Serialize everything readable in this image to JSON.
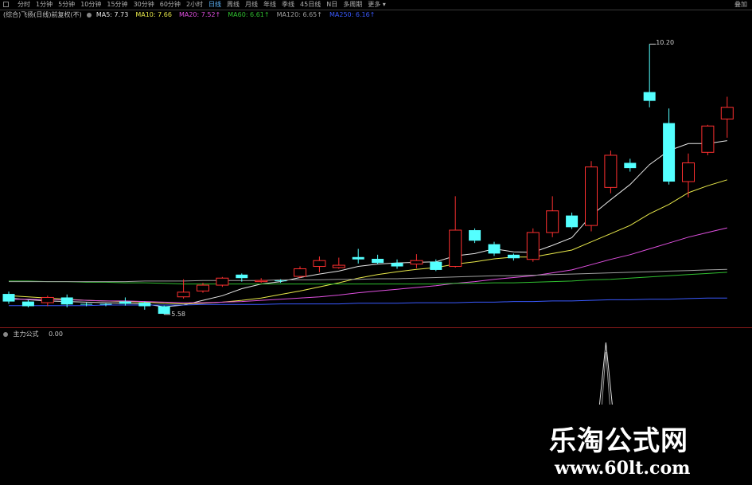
{
  "toolbar": {
    "periods": [
      "分时",
      "1分钟",
      "5分钟",
      "10分钟",
      "15分钟",
      "30分钟",
      "60分钟",
      "2小时",
      "日线",
      "周线",
      "月线",
      "年线",
      "季线",
      "45日线",
      "N日",
      "多周期"
    ],
    "active_period": "日线",
    "more_label": "更多",
    "right_buttons": [
      "叠加"
    ]
  },
  "ma_bar": {
    "title": "(综合)飞扬(日线)前复权(不)",
    "items": [
      {
        "label": "MA5: 7.73",
        "color": "#e6e6e6"
      },
      {
        "label": "MA10: 7.66",
        "color": "#e8e84a"
      },
      {
        "label": "MA20: 7.52↑",
        "color": "#e050e0"
      },
      {
        "label": "MA60: 6.61↑",
        "color": "#30c030"
      },
      {
        "label": "MA120: 6.65↑",
        "color": "#a0a0a0"
      },
      {
        "label": "MA250: 6.16↑",
        "color": "#3a5aff"
      }
    ]
  },
  "annotations": {
    "high": "10.20",
    "low": "5.58"
  },
  "sub_chart": {
    "title": "主力公式",
    "value": "0.00"
  },
  "watermark": {
    "line1": "乐淘公式网",
    "line2": "www.60lt.com"
  },
  "colors": {
    "up": "#ff3030",
    "down": "#54ffff",
    "background": "#000000"
  },
  "chart_data": {
    "type": "candlestick",
    "ylim": [
      5.4,
      10.6
    ],
    "candles": [
      {
        "o": 5.93,
        "c": 5.8,
        "h": 5.97,
        "l": 5.76
      },
      {
        "o": 5.8,
        "c": 5.72,
        "h": 5.83,
        "l": 5.7
      },
      {
        "o": 5.78,
        "c": 5.87,
        "h": 5.9,
        "l": 5.72
      },
      {
        "o": 5.87,
        "c": 5.75,
        "h": 5.92,
        "l": 5.7
      },
      {
        "o": 5.76,
        "c": 5.75,
        "h": 5.78,
        "l": 5.72
      },
      {
        "o": 5.76,
        "c": 5.75,
        "h": 5.77,
        "l": 5.72
      },
      {
        "o": 5.8,
        "c": 5.76,
        "h": 5.87,
        "l": 5.73
      },
      {
        "o": 5.78,
        "c": 5.72,
        "h": 5.8,
        "l": 5.66
      },
      {
        "o": 5.72,
        "c": 5.59,
        "h": 5.73,
        "l": 5.58
      },
      {
        "o": 5.88,
        "c": 5.96,
        "h": 6.18,
        "l": 5.85
      },
      {
        "o": 5.98,
        "c": 6.08,
        "h": 6.12,
        "l": 5.95
      },
      {
        "o": 6.08,
        "c": 6.2,
        "h": 6.22,
        "l": 6.05
      },
      {
        "o": 6.26,
        "c": 6.2,
        "h": 6.28,
        "l": 6.14
      },
      {
        "o": 6.14,
        "c": 6.16,
        "h": 6.2,
        "l": 6.12
      },
      {
        "o": 6.16,
        "c": 6.15,
        "h": 6.18,
        "l": 6.12
      },
      {
        "o": 6.23,
        "c": 6.36,
        "h": 6.4,
        "l": 6.2
      },
      {
        "o": 6.4,
        "c": 6.5,
        "h": 6.57,
        "l": 6.3
      },
      {
        "o": 6.38,
        "c": 6.42,
        "h": 6.55,
        "l": 6.36
      },
      {
        "o": 6.56,
        "c": 6.52,
        "h": 6.7,
        "l": 6.45
      },
      {
        "o": 6.53,
        "c": 6.46,
        "h": 6.6,
        "l": 6.44
      },
      {
        "o": 6.46,
        "c": 6.4,
        "h": 6.52,
        "l": 6.36
      },
      {
        "o": 6.44,
        "c": 6.5,
        "h": 6.61,
        "l": 6.37
      },
      {
        "o": 6.48,
        "c": 6.34,
        "h": 6.52,
        "l": 6.32
      },
      {
        "o": 6.4,
        "c": 7.02,
        "h": 7.6,
        "l": 6.38
      },
      {
        "o": 7.02,
        "c": 6.84,
        "h": 7.05,
        "l": 6.8
      },
      {
        "o": 6.78,
        "c": 6.62,
        "h": 6.82,
        "l": 6.58
      },
      {
        "o": 6.6,
        "c": 6.54,
        "h": 6.62,
        "l": 6.5
      },
      {
        "o": 6.52,
        "c": 6.98,
        "h": 7.05,
        "l": 6.48
      },
      {
        "o": 6.98,
        "c": 7.35,
        "h": 7.6,
        "l": 6.9
      },
      {
        "o": 7.27,
        "c": 7.07,
        "h": 7.32,
        "l": 7.04
      },
      {
        "o": 7.1,
        "c": 8.1,
        "h": 8.2,
        "l": 7.0
      },
      {
        "o": 7.75,
        "c": 8.3,
        "h": 8.38,
        "l": 7.65
      },
      {
        "o": 8.17,
        "c": 8.08,
        "h": 8.24,
        "l": 8.02
      },
      {
        "o": 9.38,
        "c": 9.23,
        "h": 10.2,
        "l": 9.12
      },
      {
        "o": 8.85,
        "c": 7.85,
        "h": 9.1,
        "l": 7.8
      },
      {
        "o": 7.85,
        "c": 8.17,
        "h": 8.33,
        "l": 7.58
      },
      {
        "o": 8.35,
        "c": 8.8,
        "h": 8.82,
        "l": 8.3
      },
      {
        "o": 8.92,
        "c": 9.12,
        "h": 9.3,
        "l": 8.6
      }
    ],
    "ma": [
      {
        "name": "MA5",
        "color": "#e6e6e6",
        "values": [
          5.86,
          5.83,
          5.81,
          5.8,
          5.79,
          5.78,
          5.77,
          5.76,
          5.71,
          5.74,
          5.82,
          5.9,
          6.02,
          6.1,
          6.14,
          6.21,
          6.27,
          6.32,
          6.4,
          6.44,
          6.46,
          6.47,
          6.48,
          6.58,
          6.62,
          6.7,
          6.65,
          6.64,
          6.76,
          6.89,
          7.27,
          7.54,
          7.8,
          8.14,
          8.38,
          8.5,
          8.5,
          8.55
        ]
      },
      {
        "name": "MA10",
        "color": "#e8e84a",
        "values": [
          5.9,
          5.88,
          5.86,
          5.84,
          5.82,
          5.81,
          5.8,
          5.79,
          5.77,
          5.76,
          5.77,
          5.79,
          5.82,
          5.86,
          5.92,
          5.98,
          6.05,
          6.12,
          6.2,
          6.26,
          6.31,
          6.35,
          6.38,
          6.44,
          6.48,
          6.53,
          6.56,
          6.56,
          6.62,
          6.68,
          6.82,
          6.96,
          7.1,
          7.3,
          7.46,
          7.66,
          7.78,
          7.88
        ]
      },
      {
        "name": "MA20",
        "color": "#e050e0",
        "values": [
          5.84,
          5.84,
          5.83,
          5.83,
          5.82,
          5.81,
          5.81,
          5.8,
          5.79,
          5.78,
          5.78,
          5.79,
          5.8,
          5.82,
          5.84,
          5.86,
          5.88,
          5.91,
          5.95,
          5.98,
          6.01,
          6.04,
          6.07,
          6.11,
          6.14,
          6.18,
          6.21,
          6.24,
          6.29,
          6.34,
          6.43,
          6.52,
          6.6,
          6.7,
          6.8,
          6.9,
          6.98,
          7.06
        ]
      },
      {
        "name": "MA60",
        "color": "#30c030",
        "values": [
          6.15,
          6.15,
          6.14,
          6.14,
          6.13,
          6.13,
          6.12,
          6.12,
          6.11,
          6.1,
          6.1,
          6.1,
          6.1,
          6.1,
          6.1,
          6.1,
          6.1,
          6.1,
          6.1,
          6.1,
          6.1,
          6.1,
          6.1,
          6.11,
          6.11,
          6.12,
          6.12,
          6.13,
          6.14,
          6.15,
          6.17,
          6.18,
          6.2,
          6.22,
          6.24,
          6.26,
          6.28,
          6.3
        ]
      },
      {
        "name": "MA120",
        "color": "#a0a0a0",
        "values": [
          6.14,
          6.14,
          6.14,
          6.14,
          6.14,
          6.14,
          6.14,
          6.15,
          6.15,
          6.15,
          6.16,
          6.16,
          6.16,
          6.16,
          6.17,
          6.17,
          6.17,
          6.18,
          6.18,
          6.19,
          6.19,
          6.2,
          6.21,
          6.22,
          6.23,
          6.24,
          6.24,
          6.25,
          6.26,
          6.27,
          6.28,
          6.29,
          6.3,
          6.31,
          6.32,
          6.33,
          6.34,
          6.35
        ]
      },
      {
        "name": "MA250",
        "color": "#3a5aff",
        "values": [
          5.73,
          5.73,
          5.73,
          5.73,
          5.73,
          5.74,
          5.74,
          5.74,
          5.74,
          5.74,
          5.75,
          5.75,
          5.75,
          5.75,
          5.76,
          5.76,
          5.76,
          5.76,
          5.77,
          5.77,
          5.77,
          5.78,
          5.78,
          5.78,
          5.79,
          5.79,
          5.8,
          5.8,
          5.81,
          5.81,
          5.82,
          5.83,
          5.83,
          5.84,
          5.84,
          5.85,
          5.86,
          5.86
        ]
      }
    ],
    "sub_series": {
      "name": "主力公式",
      "peak_index": 31,
      "peak": 1
    }
  }
}
